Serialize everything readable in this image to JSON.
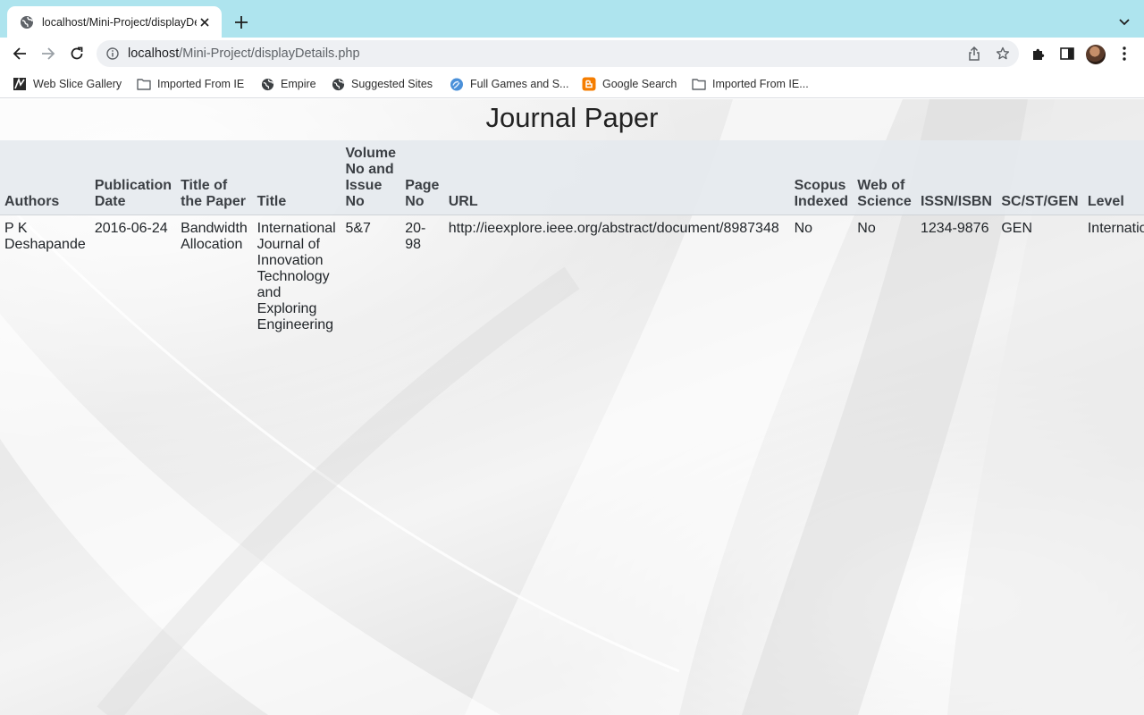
{
  "browser": {
    "tab": {
      "title": "localhost/Mini-Project/displayDetails.php"
    },
    "address_bar": {
      "host": "localhost",
      "path": "/Mini-Project/displayDetails.php"
    },
    "bookmarks": [
      {
        "label": "Web Slice Gallery",
        "icon": "web-slice-icon"
      },
      {
        "label": "Imported From IE",
        "icon": "folder-icon"
      },
      {
        "label": "Empire",
        "icon": "globe-icon"
      },
      {
        "label": "Suggested Sites",
        "icon": "globe-icon"
      },
      {
        "label": "Full Games and S...",
        "icon": "games-icon"
      },
      {
        "label": "Google Search",
        "icon": "blogger-icon"
      },
      {
        "label": "Imported From IE...",
        "icon": "folder-icon"
      }
    ]
  },
  "page": {
    "title": "Journal Paper",
    "table": {
      "headers": [
        "Authors",
        "Publication Date",
        "Title of the Paper",
        "Title",
        "Volume No and Issue No",
        "Page No",
        "URL",
        "Scopus Indexed",
        "Web of Science",
        "ISSN/ISBN",
        "SC/ST/GEN",
        "Level"
      ],
      "rows": [
        [
          "P K Deshapande",
          "2016-06-24",
          "Bandwidth Allocation",
          "International Journal of Innovation Technology and Exploring Engineering",
          "5&7",
          "20-98",
          "http://ieexplore.ieee.org/abstract/document/8987348",
          "No",
          "No",
          "1234-9876",
          "GEN",
          "International"
        ]
      ]
    }
  }
}
